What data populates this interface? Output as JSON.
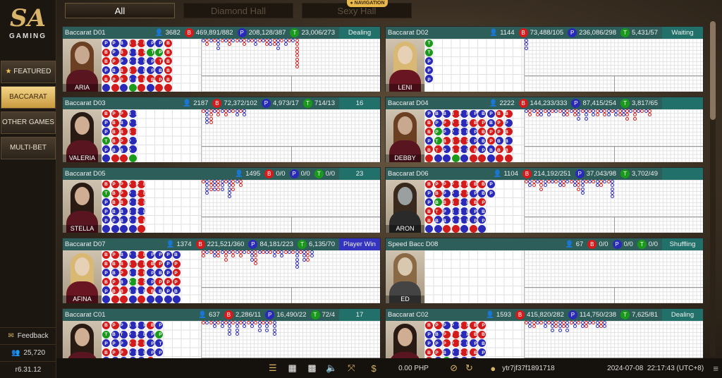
{
  "brand": {
    "logo": "SA",
    "sub": "GAMING"
  },
  "sidebar": {
    "items": [
      {
        "label": "FEATURED",
        "icon": "star-icon"
      },
      {
        "label": "BACCARAT",
        "active": true
      },
      {
        "label": "OTHER GAMES"
      },
      {
        "label": "MULTI-BET"
      }
    ],
    "feedback": "Feedback",
    "online": "25,720",
    "version": "r6.31.12"
  },
  "tabs": [
    {
      "label": "All",
      "active": true
    },
    {
      "label": "Diamond Hall"
    },
    {
      "label": "Sexy Hall"
    }
  ],
  "navigation": "NAVIGATION",
  "colors": {
    "banker": "#d41b1b",
    "player": "#2a2ab8",
    "tie": "#1a9a1a",
    "header": "#2e5e5a",
    "accent": "#d8b46a"
  },
  "tables": [
    {
      "name": "Baccarat D01",
      "players": "3682",
      "b": "469,891/882",
      "p": "208,128/387",
      "t": "23,006/273",
      "status": "Dealing",
      "dealer": "ARIA",
      "look": "brown",
      "beads": "PBBPBPPPBPBBPBPBBPBPPBPTBBPPBBPTPPBPPTBPBBBBBBBB"
    },
    {
      "name": "Baccarat D02",
      "players": "1144",
      "b": "73,488/105",
      "p": "236,086/298",
      "t": "5,431/57",
      "status": "Waiting",
      "dealer": "LENI",
      "look": "blonde",
      "beads": "TTPPP"
    },
    {
      "name": "Baccarat D03",
      "players": "2187",
      "b": "72,372/102",
      "p": "4,973/17",
      "t": "714/13",
      "status": "16",
      "dealer": "VALERIA",
      "look": "dark",
      "beads": "BPPTPPBBBBPBBPBBPBPPBPPT"
    },
    {
      "name": "Baccarat D04",
      "players": "2222",
      "b": "144,233/333",
      "p": "87,415/254",
      "t": "3,817/65",
      "status": "",
      "dealer": "DEBBY",
      "look": "brown",
      "beads": "PBBPBBPPTTBPPBPBPPBBPBBTPPPBPPPBPPBBPBBPPBPPBBPPBBBPBBBPBPBB"
    },
    {
      "name": "Baccarat D05",
      "players": "1495",
      "b": "0/0",
      "p": "0/0",
      "t": "0/0",
      "status": "23",
      "dealer": "STELLA",
      "look": "dark",
      "beads": "BTPPPPBBBPPPBBBPPPBPPPPPBBBPBB"
    },
    {
      "name": "Baccarat D06",
      "players": "1104",
      "b": "214,192/251",
      "p": "37,043/98",
      "t": "3,702/49",
      "status": "",
      "dealer": "ARON",
      "look": "male",
      "beads": "BPPBBPBBTBPPBPBPPBBPBPPBBBPPPPBPBPPBBPBPPPPP"
    },
    {
      "name": "Baccarat D07",
      "players": "1374",
      "b": "221,521/360",
      "p": "84,181/223",
      "t": "6,135/70",
      "status": "Player Win",
      "win": true,
      "dealer": "AFINA",
      "look": "blonde",
      "beads": "BBPBPPBBPBBBPBBPBBPBPTPPBBBBPBPBPPBPPBPBPPPPPBPPPBBBPP"
    },
    {
      "name": "Speed Bacc D08",
      "players": "67",
      "b": "0/0",
      "p": "0/0",
      "t": "0/0",
      "status": "Shuffling",
      "dealer": "ED",
      "look": "male2",
      "beads": ""
    },
    {
      "name": "Baccarat C01",
      "players": "637",
      "b": "2,286/11",
      "p": "16,490/22",
      "t": "72/4",
      "status": "17",
      "dealer": "",
      "look": "dark",
      "beads": "BTPBPPBPPBPTPPPBPPPPBPPBPPBPPPBPPPBPPTPP"
    },
    {
      "name": "Baccarat C02",
      "players": "1593",
      "b": "415,820/282",
      "p": "114,750/238",
      "t": "7,625/81",
      "status": "Dealing",
      "dealer": "",
      "look": "dark",
      "beads": "BPPBBPBPPBPPPBBPTPPBBPPPBPPBPPBBPBPPBBPP"
    }
  ],
  "bottombar": {
    "balance": "0.00 PHP",
    "user": "ytr7jf37f1891718",
    "datetime": "2024-07-08  22:17:43 (UTC+8)"
  }
}
